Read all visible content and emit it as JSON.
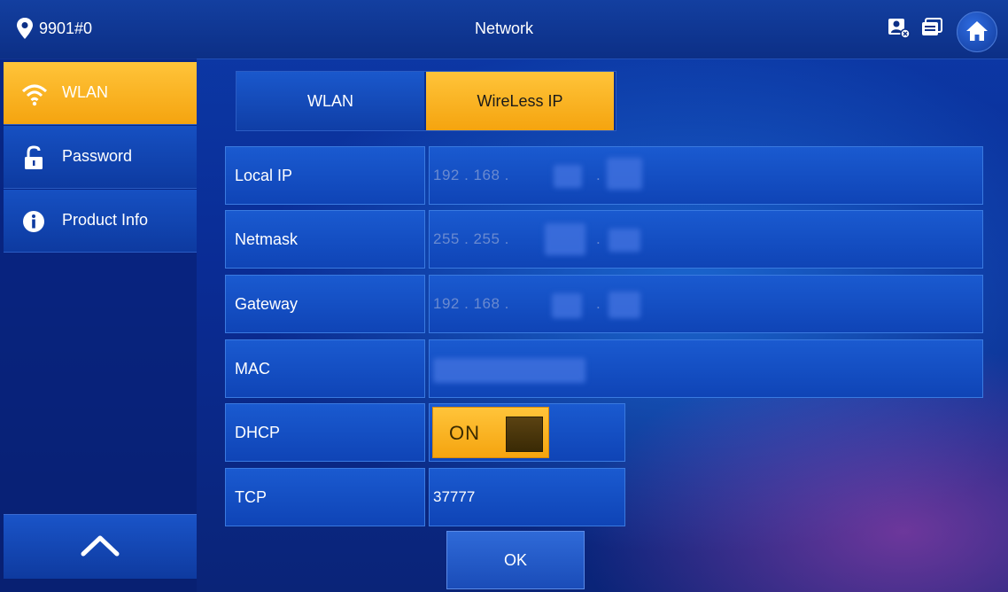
{
  "header": {
    "device_id": "9901#0",
    "title": "Network",
    "icons": [
      "location-icon",
      "contact-icon",
      "message-icon",
      "home-icon"
    ]
  },
  "sidebar": {
    "items": [
      {
        "label": "WLAN",
        "icon": "wifi-icon",
        "active": true
      },
      {
        "label": "Password",
        "icon": "lock-icon",
        "active": false
      },
      {
        "label": "Product Info",
        "icon": "info-icon",
        "active": false
      }
    ],
    "scroll_up_icon": "chevron-up-icon"
  },
  "tabs": [
    {
      "label": "WLAN",
      "active": false
    },
    {
      "label": "WireLess IP",
      "active": true
    }
  ],
  "form": {
    "local_ip": {
      "label": "Local IP",
      "prefix": "192  . 168  .",
      "suffix": "."
    },
    "netmask": {
      "label": "Netmask",
      "prefix": "255  . 255  .",
      "suffix": "."
    },
    "gateway": {
      "label": "Gateway",
      "prefix": "192  . 168  .",
      "suffix": "."
    },
    "mac": {
      "label": "MAC"
    },
    "dhcp": {
      "label": "DHCP",
      "state": "ON"
    },
    "tcp": {
      "label": "TCP",
      "value": "37777"
    }
  },
  "ok_label": "OK",
  "colors": {
    "accent": "#f5a40f",
    "panel": "#1a5ad0",
    "background": "#0a2c95"
  }
}
